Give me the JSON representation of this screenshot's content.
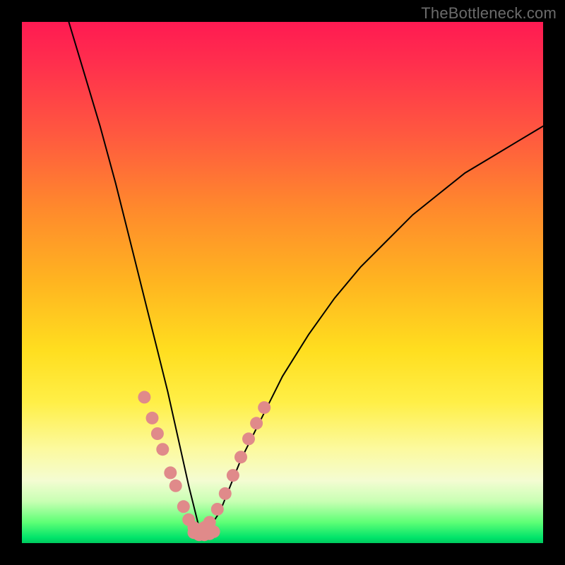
{
  "watermark": "TheBottleneck.com",
  "chart_data": {
    "type": "line",
    "title": "",
    "xlabel": "",
    "ylabel": "",
    "xlim": [
      0,
      100
    ],
    "ylim": [
      0,
      100
    ],
    "grid": false,
    "legend": false,
    "annotations": [],
    "series": [
      {
        "name": "curve",
        "description": "V-shaped bottleneck curve with minimum near x≈34; left branch steep, right branch shallower",
        "x": [
          9,
          12,
          15,
          18,
          20,
          22,
          24,
          26,
          28,
          30,
          32,
          34,
          36,
          38,
          40,
          42,
          45,
          50,
          55,
          60,
          65,
          70,
          75,
          80,
          85,
          90,
          95,
          100
        ],
        "y": [
          100,
          90,
          80,
          69,
          61,
          53,
          45,
          37,
          29,
          20,
          11,
          3,
          3,
          6,
          11,
          16,
          22,
          32,
          40,
          47,
          53,
          58,
          63,
          67,
          71,
          74,
          77,
          80
        ]
      },
      {
        "name": "left-beads",
        "description": "salmon-colored dots along lower-left branch",
        "x": [
          23.5,
          25.0,
          26.0,
          27.0,
          28.5,
          29.5,
          31.0,
          32.0,
          33.0
        ],
        "y": [
          28.0,
          24.0,
          21.0,
          18.0,
          13.5,
          11.0,
          7.0,
          4.5,
          3.0
        ]
      },
      {
        "name": "right-beads",
        "description": "salmon-colored dots along lower-right branch",
        "x": [
          35.0,
          36.0,
          37.5,
          39.0,
          40.5,
          42.0,
          43.5,
          45.0,
          46.5
        ],
        "y": [
          3.0,
          4.0,
          6.5,
          9.5,
          13.0,
          16.5,
          20.0,
          23.0,
          26.0
        ]
      },
      {
        "name": "bottom-beads",
        "description": "cluster at the trough",
        "x": [
          33.0,
          34.0,
          35.0,
          36.0,
          36.8
        ],
        "y": [
          2.0,
          1.6,
          1.6,
          1.8,
          2.2
        ]
      }
    ],
    "colors": {
      "curve": "#000000",
      "beads": "#e08a8a",
      "gradient_top": "#ff1a52",
      "gradient_mid": "#ffde1f",
      "gradient_bottom": "#00c95e",
      "frame": "#000000"
    }
  }
}
